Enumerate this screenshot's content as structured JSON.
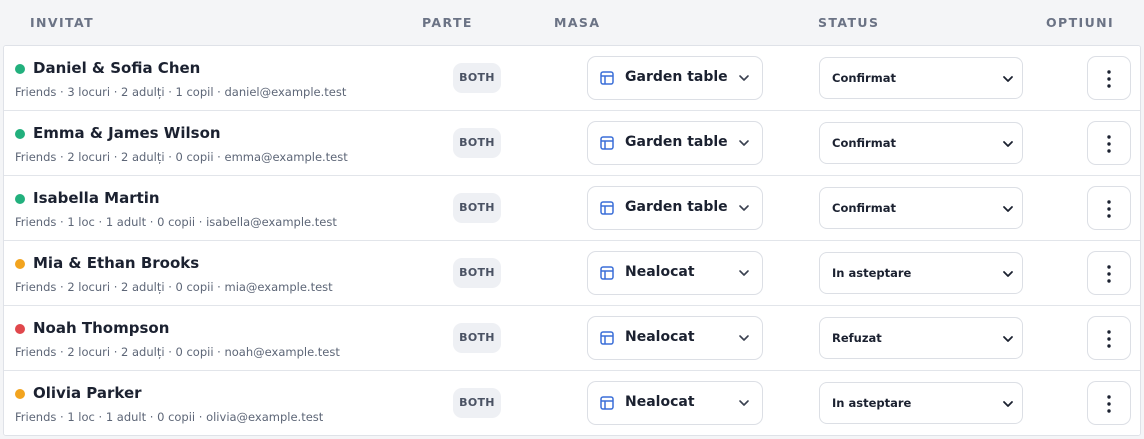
{
  "header": {
    "invitat": "INVITAT",
    "parte": "PARTE",
    "masa": "MASA",
    "status": "STATUS",
    "optiuni": "OPTIUNI"
  },
  "colors": {
    "confirmed": "#22b07d",
    "pending": "#f2a41f",
    "declined": "#e0474c"
  },
  "rows": [
    {
      "name": "Daniel & Sofia Chen",
      "meta": "Friends · 3 locuri · 2 adulți · 1 copil · daniel@example.test",
      "side": "BOTH",
      "table": "Garden table",
      "status": "Confirmat",
      "dot": "green"
    },
    {
      "name": "Emma & James Wilson",
      "meta": "Friends · 2 locuri · 2 adulți · 0 copii · emma@example.test",
      "side": "BOTH",
      "table": "Garden table",
      "status": "Confirmat",
      "dot": "green"
    },
    {
      "name": "Isabella Martin",
      "meta": "Friends · 1 loc · 1 adult · 0 copii · isabella@example.test",
      "side": "BOTH",
      "table": "Garden table",
      "status": "Confirmat",
      "dot": "green"
    },
    {
      "name": "Mia & Ethan Brooks",
      "meta": "Friends · 2 locuri · 2 adulți · 0 copii · mia@example.test",
      "side": "BOTH",
      "table": "Nealocat",
      "status": "In asteptare",
      "dot": "orange"
    },
    {
      "name": "Noah Thompson",
      "meta": "Friends · 2 locuri · 2 adulți · 0 copii · noah@example.test",
      "side": "BOTH",
      "table": "Nealocat",
      "status": "Refuzat",
      "dot": "red"
    },
    {
      "name": "Olivia Parker",
      "meta": "Friends · 1 loc · 1 adult · 0 copii · olivia@example.test",
      "side": "BOTH",
      "table": "Nealocat",
      "status": "In asteptare",
      "dot": "orange"
    }
  ]
}
